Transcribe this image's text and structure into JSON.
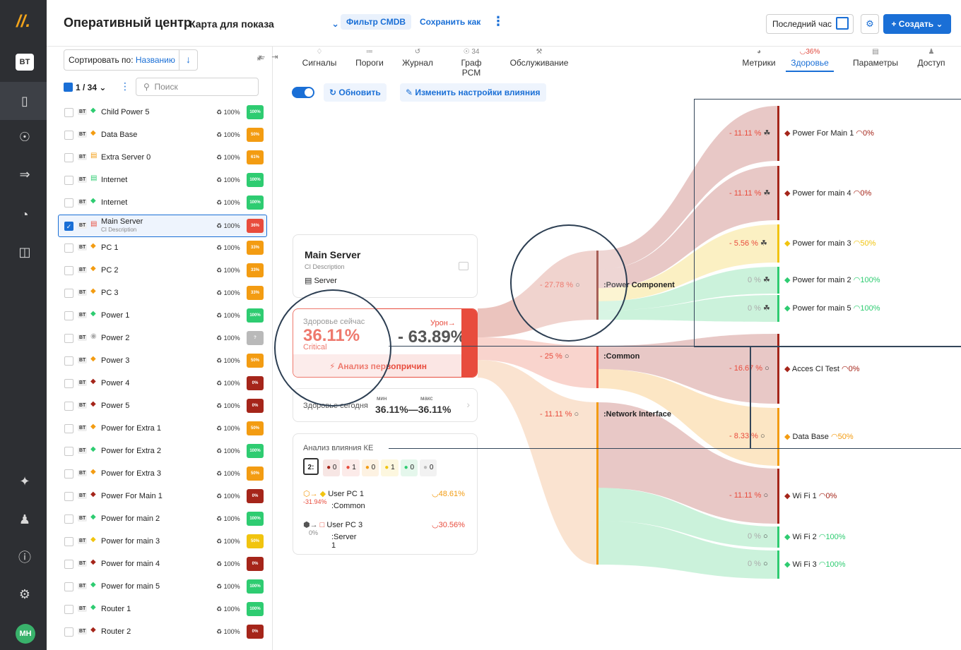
{
  "topbar": {
    "title": "Оперативный центр",
    "map": "Карта для показа",
    "cmdb_filter": "Фильтр CMDB",
    "save_as": "Сохранить как",
    "period": "Последний час",
    "create": "+ Создать"
  },
  "rail": {
    "user_initials": "BT",
    "avatar_initials": "MH",
    "logo": "//."
  },
  "list": {
    "sort_label": "Сортировать по: ",
    "sort_value": "Названию",
    "count": "1 / 34",
    "search_placeholder": "Поиск",
    "rows": [
      {
        "name": "Child Power 5",
        "icon": "layers",
        "color": "#2ecc71",
        "pct": "100%",
        "badge": "100%",
        "badge_color": "#2ecc71"
      },
      {
        "name": "Data Base",
        "icon": "layers",
        "color": "#f39c12",
        "pct": "100%",
        "badge": "50%",
        "badge_color": "#f39c12"
      },
      {
        "name": "Extra Server 0",
        "icon": "server",
        "color": "#f39c12",
        "pct": "100%",
        "badge": "61%",
        "badge_color": "#f39c12"
      },
      {
        "name": "Internet",
        "icon": "server",
        "color": "#2ecc71",
        "pct": "100%",
        "badge": "100%",
        "badge_color": "#2ecc71"
      },
      {
        "name": "Internet",
        "icon": "layers",
        "color": "#2ecc71",
        "pct": "100%",
        "badge": "100%",
        "badge_color": "#2ecc71"
      },
      {
        "name": "Main Server",
        "sub": "CI Description",
        "icon": "server",
        "color": "#e84c3d",
        "pct": "100%",
        "badge": "36%",
        "badge_color": "#e84c3d",
        "selected": true
      },
      {
        "name": "PC 1",
        "icon": "layers",
        "color": "#f39c12",
        "pct": "100%",
        "badge": "33%",
        "badge_color": "#f39c12"
      },
      {
        "name": "PC 2",
        "icon": "layers",
        "color": "#f39c12",
        "pct": "100%",
        "badge": "33%",
        "badge_color": "#f39c12"
      },
      {
        "name": "PC 3",
        "icon": "layers",
        "color": "#f39c12",
        "pct": "100%",
        "badge": "33%",
        "badge_color": "#f39c12"
      },
      {
        "name": "Power 1",
        "icon": "layers",
        "color": "#2ecc71",
        "pct": "100%",
        "badge": "100%",
        "badge_color": "#2ecc71"
      },
      {
        "name": "Power 2",
        "icon": "unknown",
        "color": "#aaaaaa",
        "pct": "100%",
        "badge": "?",
        "badge_color": "#b9b9b9"
      },
      {
        "name": "Power 3",
        "icon": "layers",
        "color": "#f39c12",
        "pct": "100%",
        "badge": "50%",
        "badge_color": "#f39c12"
      },
      {
        "name": "Power 4",
        "icon": "layers",
        "color": "#a5251a",
        "pct": "100%",
        "badge": "0%",
        "badge_color": "#a5251a"
      },
      {
        "name": "Power 5",
        "icon": "layers",
        "color": "#a5251a",
        "pct": "100%",
        "badge": "0%",
        "badge_color": "#a5251a"
      },
      {
        "name": "Power for Extra 1",
        "icon": "layers",
        "color": "#f39c12",
        "pct": "100%",
        "badge": "50%",
        "badge_color": "#f39c12"
      },
      {
        "name": "Power for Extra 2",
        "icon": "layers",
        "color": "#2ecc71",
        "pct": "100%",
        "badge": "100%",
        "badge_color": "#2ecc71"
      },
      {
        "name": "Power for Extra 3",
        "icon": "layers",
        "color": "#f39c12",
        "pct": "100%",
        "badge": "50%",
        "badge_color": "#f39c12"
      },
      {
        "name": "Power For Main 1",
        "icon": "layers",
        "color": "#a5251a",
        "pct": "100%",
        "badge": "0%",
        "badge_color": "#a5251a"
      },
      {
        "name": "Power for main 2",
        "icon": "layers",
        "color": "#2ecc71",
        "pct": "100%",
        "badge": "100%",
        "badge_color": "#2ecc71"
      },
      {
        "name": "Power for main 3",
        "icon": "layers",
        "color": "#f1c40f",
        "pct": "100%",
        "badge": "50%",
        "badge_color": "#f1c40f"
      },
      {
        "name": "Power for main 4",
        "icon": "layers",
        "color": "#a5251a",
        "pct": "100%",
        "badge": "0%",
        "badge_color": "#a5251a"
      },
      {
        "name": "Power for main 5",
        "icon": "layers",
        "color": "#2ecc71",
        "pct": "100%",
        "badge": "100%",
        "badge_color": "#2ecc71"
      },
      {
        "name": "Router 1",
        "icon": "layers",
        "color": "#2ecc71",
        "pct": "100%",
        "badge": "100%",
        "badge_color": "#2ecc71"
      },
      {
        "name": "Router 2",
        "icon": "layers",
        "color": "#a5251a",
        "pct": "100%",
        "badge": "0%",
        "badge_color": "#a5251a"
      }
    ]
  },
  "tabs_left": [
    {
      "label": "Сигналы",
      "top": ""
    },
    {
      "label": "Пороги",
      "top": ""
    },
    {
      "label": "Журнал",
      "top": ""
    },
    {
      "label": "Граф РСМ",
      "top": "34"
    },
    {
      "label": "Обслуживание",
      "top": ""
    }
  ],
  "tabs_right": [
    {
      "label": "Метрики",
      "top": ""
    },
    {
      "label": "Здоровье",
      "top": "36%",
      "active": true
    },
    {
      "label": "Параметры",
      "top": ""
    },
    {
      "label": "Доступ",
      "top": ""
    }
  ],
  "toolbar": {
    "refresh": "Обновить",
    "edit_influence": "Изменить настройки влияния"
  },
  "ci": {
    "name": "Main Server",
    "description": "CI Description",
    "type": "Server"
  },
  "health": {
    "label": "Здоровье сейчас",
    "value": "36.11%",
    "status": "Critical",
    "damage_label": "Урон",
    "damage": "- 63.89%",
    "rca": "Анализ первопричин"
  },
  "today": {
    "label": "Здоровье сегодня",
    "min_label": "мин",
    "max_label": "макс",
    "range": "36.11%—36.11%"
  },
  "impact": {
    "title": "Анализ влияния КЕ",
    "total": "2:",
    "chips": [
      {
        "value": "0",
        "color": "#a5251a",
        "bg": "#f7e6e4"
      },
      {
        "value": "1",
        "color": "#e84c3d",
        "bg": "#fcebe9"
      },
      {
        "value": "0",
        "color": "#f39c12",
        "bg": "#fdf2e2"
      },
      {
        "value": "1",
        "color": "#f1c40f",
        "bg": "#fdf7df"
      },
      {
        "value": "0",
        "color": "#2ecc71",
        "bg": "#e5f7ec"
      },
      {
        "value": "0",
        "color": "#bbbbbb",
        "bg": "#f2f2f2"
      }
    ],
    "items": [
      {
        "name": "User PC 1",
        "group": ":Common",
        "delta": "-31.94%",
        "health": "48.61%"
      },
      {
        "name": "User PC 3",
        "group": ":Server 1",
        "delta": "0%",
        "health": "30.56%"
      }
    ]
  },
  "sankey": {
    "groups": [
      {
        "name": ":Power Component",
        "pct": "- 27.78 %"
      },
      {
        "name": ":Common",
        "pct": "- 25 %"
      },
      {
        "name": ":Network Interface",
        "pct": "- 11.11 %"
      }
    ],
    "leaves": [
      {
        "name": "Power For Main 1",
        "pct": "- 11.11 %",
        "health": "0%",
        "color": "#a5251a"
      },
      {
        "name": "Power for main 4",
        "pct": "- 11.11 %",
        "health": "0%",
        "color": "#a5251a"
      },
      {
        "name": "Power for main 3",
        "pct": "- 5.56 %",
        "health": "50%",
        "color": "#f1c40f"
      },
      {
        "name": "Power for main 2",
        "pct": "0 %",
        "health": "100%",
        "color": "#2ecc71"
      },
      {
        "name": "Power for main 5",
        "pct": "0 %",
        "health": "100%",
        "color": "#2ecc71"
      },
      {
        "name": "Acces CI Test",
        "pct": "- 16.67 %",
        "health": "0%",
        "color": "#a5251a"
      },
      {
        "name": "Data Base",
        "pct": "- 8.33 %",
        "health": "50%",
        "color": "#f39c12"
      },
      {
        "name": "Wi Fi 1",
        "pct": "- 11.11 %",
        "health": "0%",
        "color": "#a5251a"
      },
      {
        "name": "Wi Fi 2",
        "pct": "0 %",
        "health": "100%",
        "color": "#2ecc71"
      },
      {
        "name": "Wi Fi 3",
        "pct": "0 %",
        "health": "100%",
        "color": "#2ecc71"
      }
    ]
  }
}
